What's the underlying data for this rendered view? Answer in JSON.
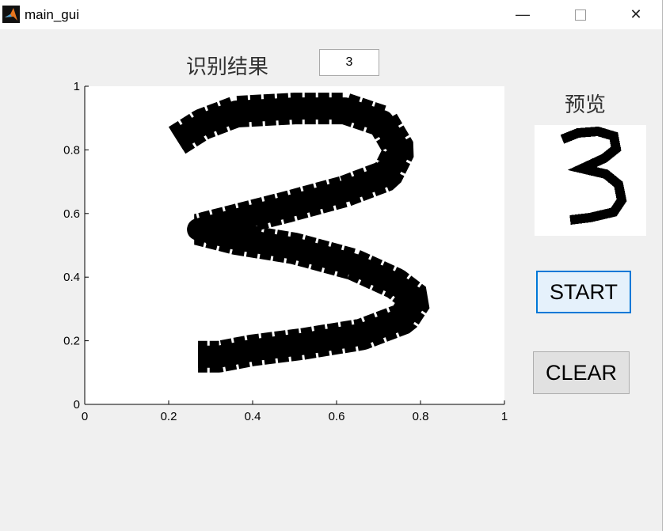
{
  "window": {
    "title": "main_gui",
    "minimize_icon": "minimize-icon",
    "maximize_icon": "maximize-icon",
    "close_icon": "close-icon"
  },
  "result": {
    "label": "识别结果",
    "value": "3"
  },
  "preview": {
    "label": "预览"
  },
  "buttons": {
    "start": "START",
    "clear": "CLEAR"
  },
  "axes": {
    "xlim": [
      0,
      1
    ],
    "ylim": [
      0,
      1
    ],
    "xticks": [
      "0",
      "0.2",
      "0.4",
      "0.6",
      "0.8",
      "1"
    ],
    "yticks": [
      "0",
      "0.2",
      "0.4",
      "0.6",
      "0.8",
      "1"
    ],
    "drawing_points": [
      [
        0.22,
        0.83
      ],
      [
        0.28,
        0.88
      ],
      [
        0.36,
        0.92
      ],
      [
        0.5,
        0.93
      ],
      [
        0.62,
        0.93
      ],
      [
        0.71,
        0.89
      ],
      [
        0.75,
        0.8
      ],
      [
        0.72,
        0.72
      ],
      [
        0.62,
        0.67
      ],
      [
        0.48,
        0.62
      ],
      [
        0.36,
        0.58
      ],
      [
        0.27,
        0.55
      ],
      [
        0.36,
        0.52
      ],
      [
        0.5,
        0.49
      ],
      [
        0.64,
        0.44
      ],
      [
        0.74,
        0.38
      ],
      [
        0.79,
        0.33
      ],
      [
        0.76,
        0.27
      ],
      [
        0.66,
        0.22
      ],
      [
        0.52,
        0.19
      ],
      [
        0.4,
        0.17
      ],
      [
        0.32,
        0.15
      ],
      [
        0.27,
        0.15
      ]
    ]
  }
}
